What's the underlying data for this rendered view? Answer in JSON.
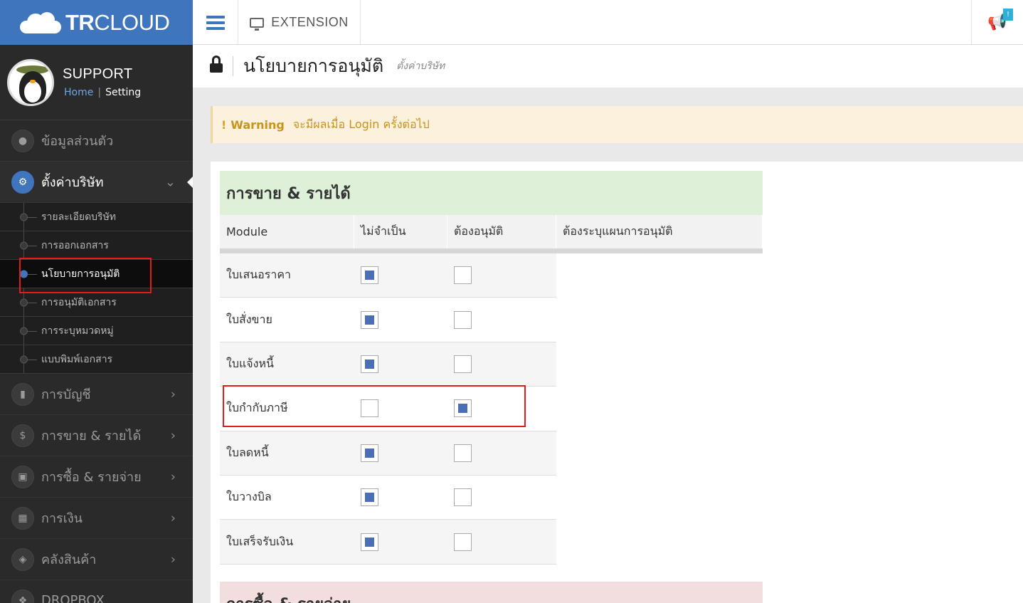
{
  "logo": {
    "bold": "TR",
    "light": "CLOUD"
  },
  "topbar": {
    "extension_label": "EXTENSION",
    "notification_badge": "!"
  },
  "profile": {
    "name": "SUPPORT",
    "home_link": "Home",
    "separator": "|",
    "setting_link": "Setting"
  },
  "sidebar": {
    "personal": "ข้อมูลส่วนตัว",
    "company_settings": "ตั้งค่าบริษัท",
    "submenu": [
      "รายละเอียดบริษัท",
      "การออกเอกสาร",
      "นโยบายการอนุมัติ",
      "การอนุมัติเอกสาร",
      "การระบุหมวดหมู่",
      "แบบพิมพ์เอกสาร"
    ],
    "accounting": "การบัญชี",
    "sales_income": "การขาย & รายได้",
    "purchase_expense": "การซื้อ & รายจ่าย",
    "finance": "การเงิน",
    "inventory": "คลังสินค้า",
    "dropbox": "DROPBOX"
  },
  "page": {
    "title": "นโยบายการอนุมัติ",
    "subtitle": "ตั้งค่าบริษัท"
  },
  "warning": {
    "bang": "!",
    "title": "Warning",
    "text": "จะมีผลเมื่อ Login ครั้งต่อไป"
  },
  "sales_section": {
    "title": "การขาย & รายได้",
    "headers": [
      "Module",
      "ไม่จำเป็น",
      "ต้องอนุมัติ",
      "ต้องระบุแผนการอนุมัติ"
    ],
    "rows": [
      {
        "module": "ใบเสนอราคา",
        "not_required": true,
        "require_approval": false
      },
      {
        "module": "ใบสั่งขาย",
        "not_required": true,
        "require_approval": false
      },
      {
        "module": "ใบแจ้งหนี้",
        "not_required": true,
        "require_approval": false
      },
      {
        "module": "ใบกำกับภาษี",
        "not_required": false,
        "require_approval": true
      },
      {
        "module": "ใบลดหนี้",
        "not_required": true,
        "require_approval": false
      },
      {
        "module": "ใบวางบิล",
        "not_required": true,
        "require_approval": false
      },
      {
        "module": "ใบเสร็จรับเงิน",
        "not_required": true,
        "require_approval": false
      }
    ]
  },
  "purchase_section": {
    "title": "การซื้อ & รายจ่าย"
  }
}
